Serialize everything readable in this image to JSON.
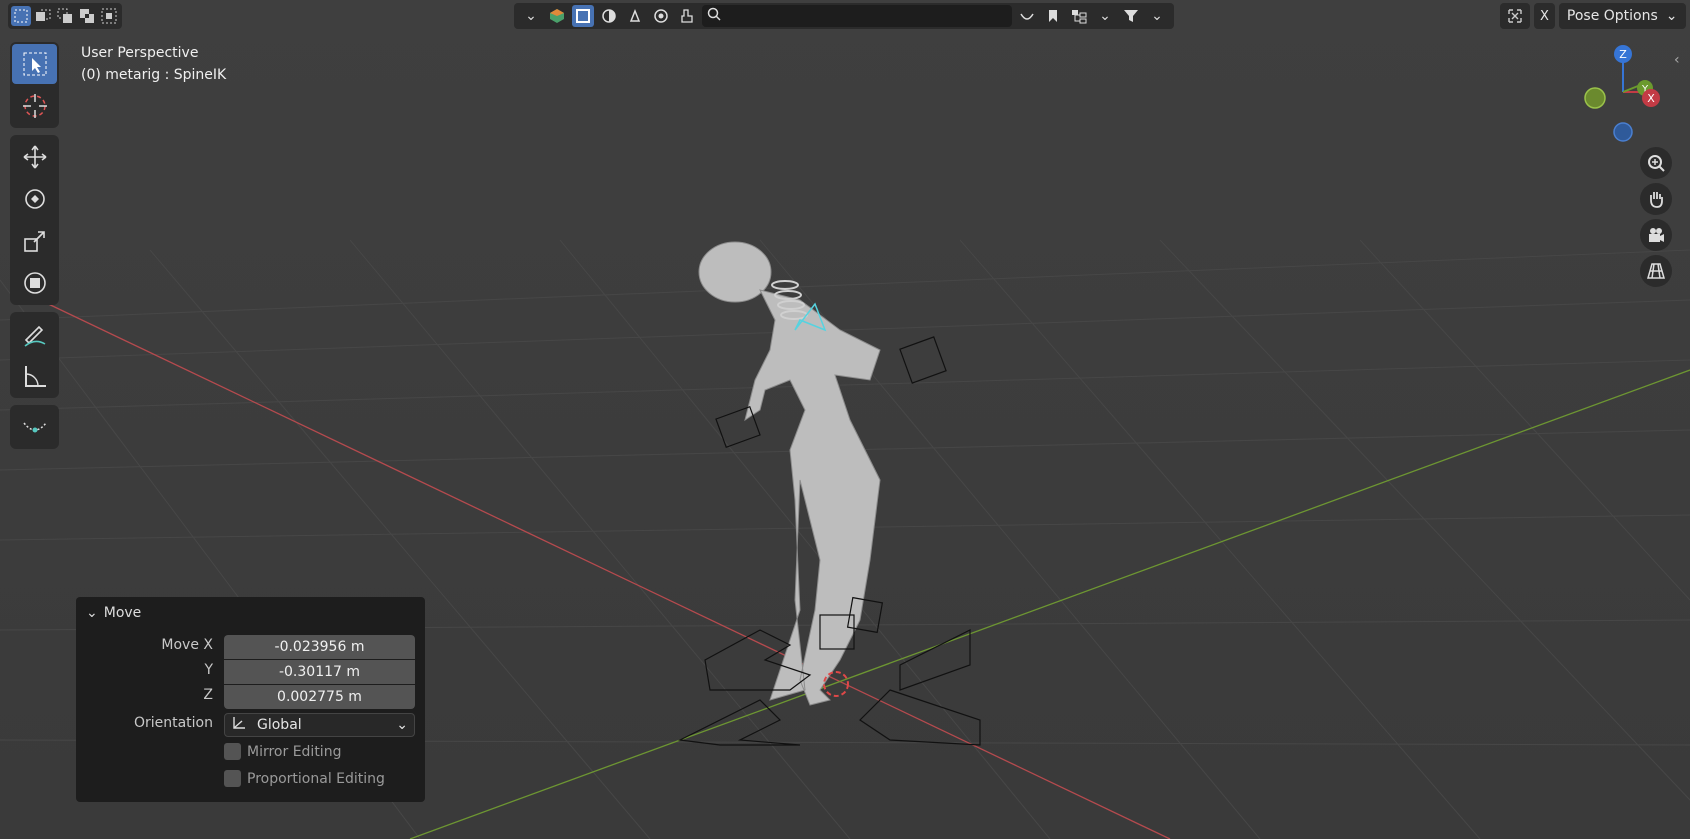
{
  "header": {
    "selection_modes": [
      "select-new",
      "select-extend",
      "select-subtract",
      "select-difference",
      "select-intersect"
    ],
    "search": {
      "value": "",
      "placeholder": ""
    },
    "close_label": "X",
    "pose_options_label": "Pose Options"
  },
  "viewport": {
    "view_name": "User Perspective",
    "object_info": "(0) metarig : SpineIK"
  },
  "gizmo": {
    "z_label": "Z",
    "y_label": "Y",
    "x_label": "X"
  },
  "operator_panel": {
    "title": "Move",
    "move_x_label": "Move X",
    "move_x_value": "-0.023956 m",
    "y_label": "Y",
    "y_value": "-0.30117 m",
    "z_label": "Z",
    "z_value": "0.002775 m",
    "orientation_label": "Orientation",
    "orientation_value": "Global",
    "mirror_label": "Mirror Editing",
    "proportional_label": "Proportional Editing"
  },
  "colors": {
    "accent": "#4772b3",
    "x_axis": "#c33b45",
    "y_axis": "#6b9a2e",
    "z_axis": "#3675d6"
  }
}
